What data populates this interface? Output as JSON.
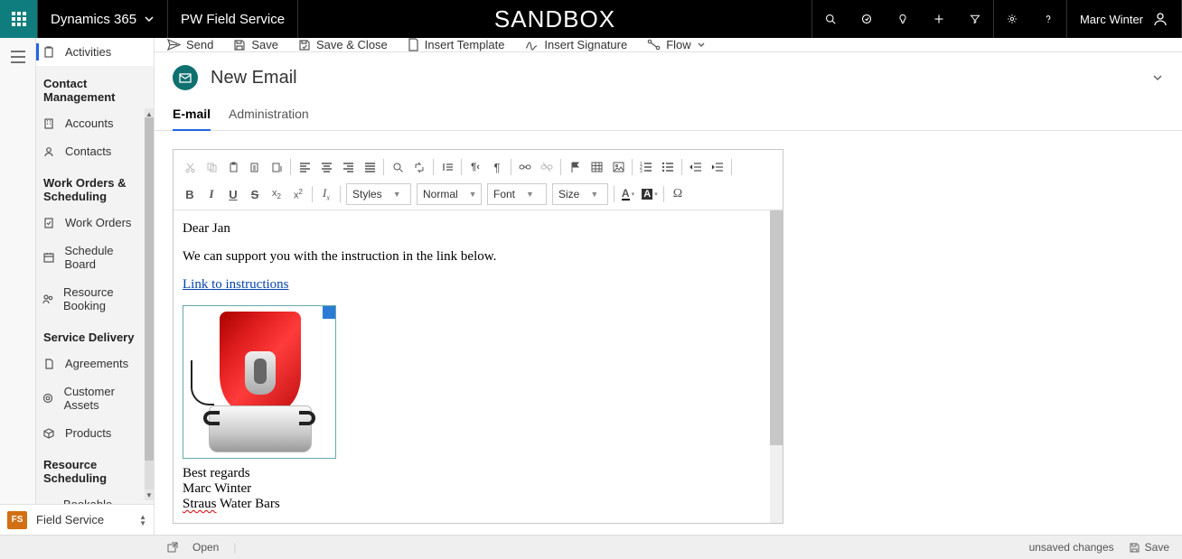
{
  "topbar": {
    "brand": "Dynamics 365",
    "app": "PW Field Service",
    "env": "SANDBOX",
    "user": "Marc Winter"
  },
  "commands": {
    "send": "Send",
    "save": "Save",
    "save_close": "Save & Close",
    "insert_template": "Insert Template",
    "insert_signature": "Insert Signature",
    "flow": "Flow"
  },
  "record": {
    "title": "New Email"
  },
  "tabs": {
    "email": "E-mail",
    "admin": "Administration"
  },
  "sidebar": {
    "activities": "Activities",
    "sec_contact": "Contact Management",
    "accounts": "Accounts",
    "contacts": "Contacts",
    "sec_wo": "Work Orders & Scheduling",
    "work_orders": "Work Orders",
    "schedule_board": "Schedule Board",
    "resource_booking": "Resource Booking",
    "sec_service": "Service Delivery",
    "agreements": "Agreements",
    "customer_assets": "Customer Assets",
    "products": "Products",
    "sec_resource": "Resource Scheduling",
    "bookable": "Bookable Resources"
  },
  "area": {
    "badge": "FS",
    "label": "Field Service"
  },
  "editor_dropdowns": {
    "styles": "Styles",
    "format": "Normal",
    "font": "Font",
    "size": "Size"
  },
  "email_body": {
    "greeting": "Dear Jan",
    "line1": "We can support you with the instruction in the link below.",
    "link_text": "Link to instructions",
    "sig1": "Best regards",
    "sig2": "Marc Winter",
    "sig3a": "Straus",
    "sig3b": " Water Bars"
  },
  "status": {
    "open": "Open",
    "unsaved": "unsaved changes",
    "save": "Save"
  }
}
